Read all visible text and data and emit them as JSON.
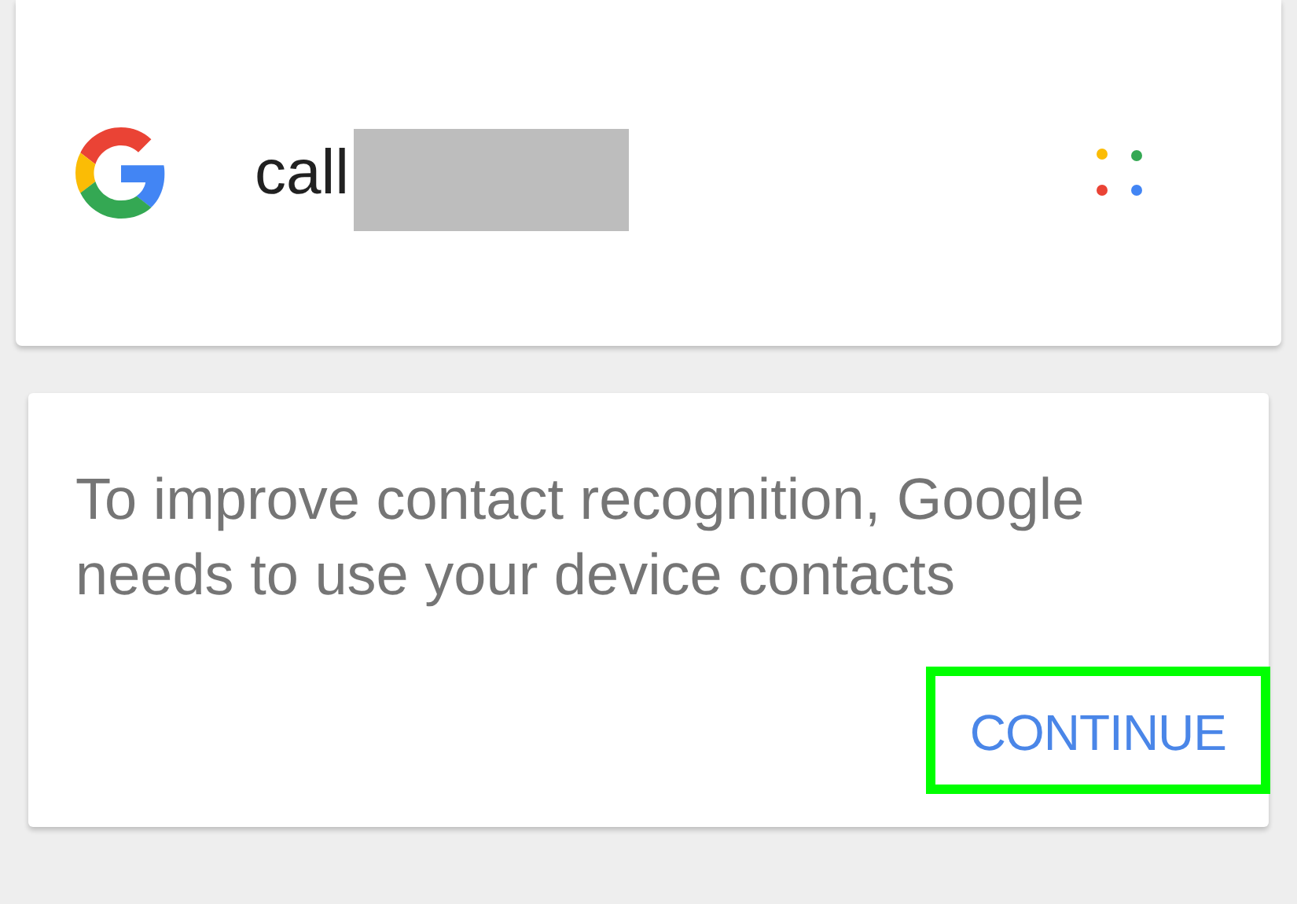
{
  "search_card": {
    "query": "call"
  },
  "permission_card": {
    "message": "To improve contact recognition, Google needs to use your device contacts",
    "button": {
      "label": "CONTINUE",
      "highlighted": true
    }
  }
}
